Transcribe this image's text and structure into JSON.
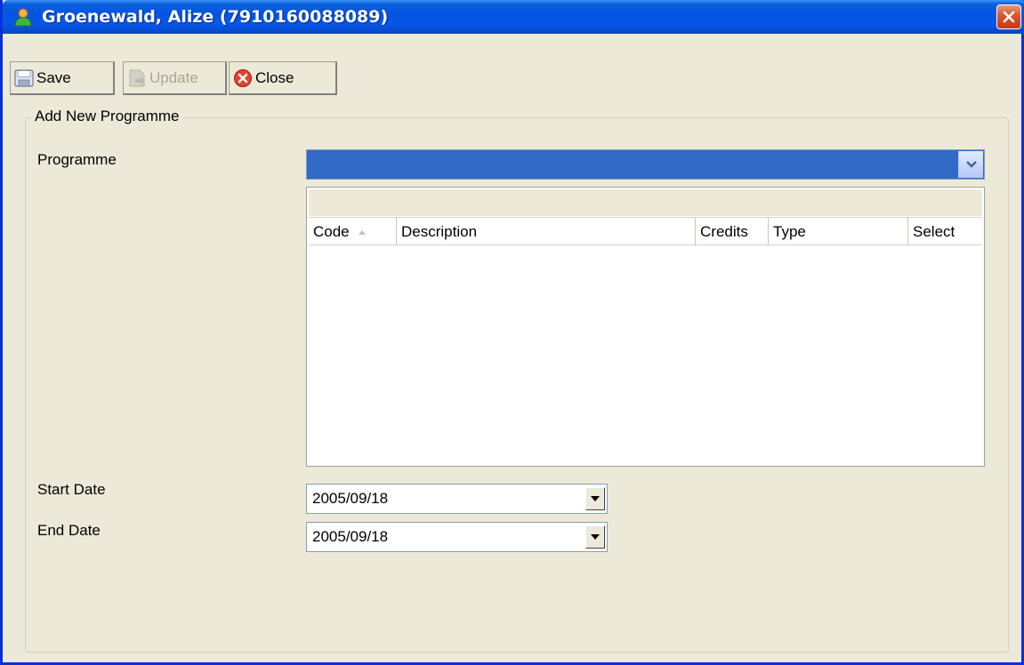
{
  "window": {
    "title": "Groenewald, Alize  (7910160088089)",
    "icon": "user-icon"
  },
  "toolbar": {
    "save_label": "Save",
    "update_label": "Update",
    "close_label": "Close"
  },
  "group": {
    "legend": "Add New Programme"
  },
  "form": {
    "programme_label": "Programme",
    "programme_value": "",
    "start_date_label": "Start Date",
    "start_date_value": "2005/09/18",
    "end_date_label": "End Date",
    "end_date_value": "2005/09/18"
  },
  "grid": {
    "columns": [
      "Code",
      "Description",
      "Credits",
      "Type",
      "Select"
    ],
    "rows": []
  },
  "colors": {
    "titlebar": "#0554e3",
    "selection": "#316ac5",
    "window_bg": "#ece9d8"
  }
}
